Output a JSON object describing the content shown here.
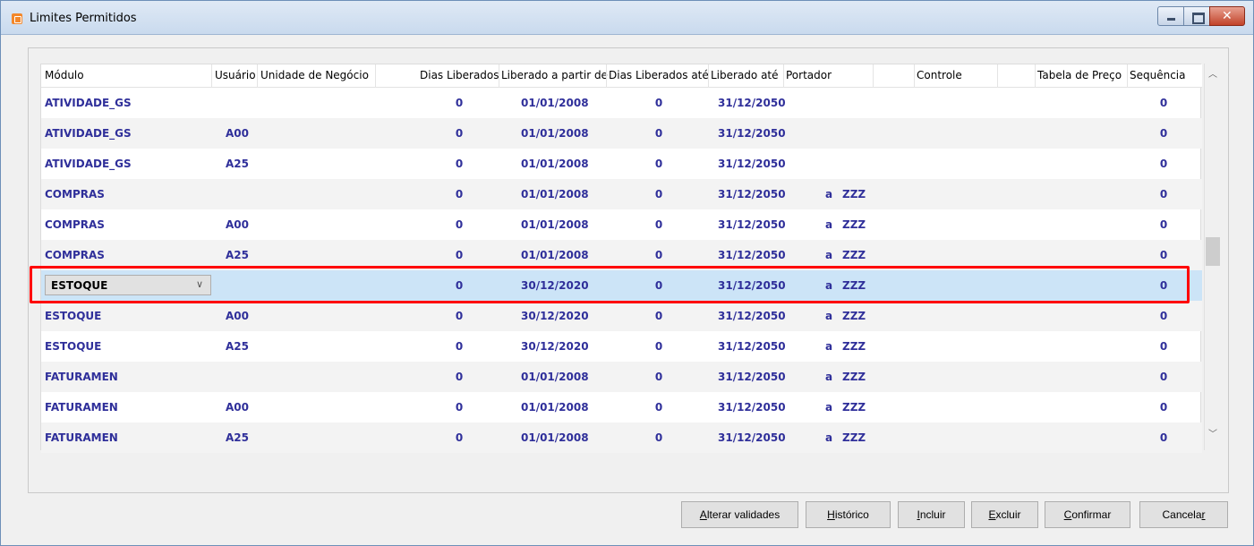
{
  "window": {
    "title": "Limites Permitidos"
  },
  "columns": [
    "Módulo",
    "Usuário",
    "Unidade de Negócio",
    "Dias Liberados",
    "Liberado a partir de",
    "Dias Liberados até",
    "Liberado até",
    "Portador",
    "Controle",
    "Tabela de Preço",
    "Sequência"
  ],
  "rows": [
    {
      "modulo": "ATIVIDADE_GS",
      "usuario": "",
      "dias": "0",
      "apartir": "01/01/2008",
      "diasate": "0",
      "ate": "31/12/2050",
      "port_a": "",
      "port_b": "",
      "seq": "0"
    },
    {
      "modulo": "ATIVIDADE_GS",
      "usuario": "A00",
      "dias": "0",
      "apartir": "01/01/2008",
      "diasate": "0",
      "ate": "31/12/2050",
      "port_a": "",
      "port_b": "",
      "seq": "0"
    },
    {
      "modulo": "ATIVIDADE_GS",
      "usuario": "A25",
      "dias": "0",
      "apartir": "01/01/2008",
      "diasate": "0",
      "ate": "31/12/2050",
      "port_a": "",
      "port_b": "",
      "seq": "0"
    },
    {
      "modulo": "COMPRAS",
      "usuario": "",
      "dias": "0",
      "apartir": "01/01/2008",
      "diasate": "0",
      "ate": "31/12/2050",
      "port_a": "a",
      "port_b": "ZZZ",
      "seq": "0"
    },
    {
      "modulo": "COMPRAS",
      "usuario": "A00",
      "dias": "0",
      "apartir": "01/01/2008",
      "diasate": "0",
      "ate": "31/12/2050",
      "port_a": "a",
      "port_b": "ZZZ",
      "seq": "0"
    },
    {
      "modulo": "COMPRAS",
      "usuario": "A25",
      "dias": "0",
      "apartir": "01/01/2008",
      "diasate": "0",
      "ate": "31/12/2050",
      "port_a": "a",
      "port_b": "ZZZ",
      "seq": "0"
    },
    {
      "modulo": "ESTOQUE",
      "usuario": "",
      "dias": "0",
      "apartir": "30/12/2020",
      "diasate": "0",
      "ate": "31/12/2050",
      "port_a": "a",
      "port_b": "ZZZ",
      "seq": "0"
    },
    {
      "modulo": "ESTOQUE",
      "usuario": "A00",
      "dias": "0",
      "apartir": "30/12/2020",
      "diasate": "0",
      "ate": "31/12/2050",
      "port_a": "a",
      "port_b": "ZZZ",
      "seq": "0"
    },
    {
      "modulo": "ESTOQUE",
      "usuario": "A25",
      "dias": "0",
      "apartir": "30/12/2020",
      "diasate": "0",
      "ate": "31/12/2050",
      "port_a": "a",
      "port_b": "ZZZ",
      "seq": "0"
    },
    {
      "modulo": "FATURAMEN",
      "usuario": "",
      "dias": "0",
      "apartir": "01/01/2008",
      "diasate": "0",
      "ate": "31/12/2050",
      "port_a": "a",
      "port_b": "ZZZ",
      "seq": "0"
    },
    {
      "modulo": "FATURAMEN",
      "usuario": "A00",
      "dias": "0",
      "apartir": "01/01/2008",
      "diasate": "0",
      "ate": "31/12/2050",
      "port_a": "a",
      "port_b": "ZZZ",
      "seq": "0"
    },
    {
      "modulo": "FATURAMEN",
      "usuario": "A25",
      "dias": "0",
      "apartir": "01/01/2008",
      "diasate": "0",
      "ate": "31/12/2050",
      "port_a": "a",
      "port_b": "ZZZ",
      "seq": "0"
    }
  ],
  "selected_row_index": 6,
  "buttons": {
    "alterar": {
      "first": "A",
      "rest": "lterar validades"
    },
    "historico": {
      "first": "H",
      "rest": "istórico"
    },
    "incluir": {
      "first": "I",
      "rest": "ncluir"
    },
    "excluir": {
      "first": "E",
      "rest": "xcluir"
    },
    "confirmar": {
      "first": "C",
      "rest": "onfirmar"
    },
    "cancelar": {
      "first": "Cancela",
      "rest": "r"
    }
  },
  "colors": {
    "text_blue": "#2f2f9a",
    "selection": "#cce4f7",
    "highlight": "#ff0000"
  }
}
